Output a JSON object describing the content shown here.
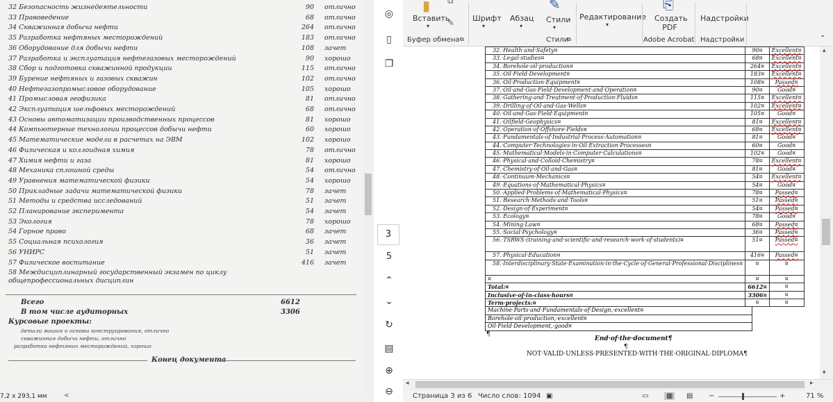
{
  "scan": {
    "rows": [
      {
        "n": "32 Безопасность жизнедеятельности",
        "h": "90",
        "g": "отлично"
      },
      {
        "n": "33 Правоведение",
        "h": "68",
        "g": "отлично"
      },
      {
        "n": "34 Скважинная добыча нефти",
        "h": "264",
        "g": "отлично"
      },
      {
        "n": "35 Разработка нефтяных месторождений",
        "h": "183",
        "g": "отлично"
      },
      {
        "n": "36 Оборудование для добычи нефти",
        "h": "108",
        "g": "зачет"
      },
      {
        "n": "37 Разработка и эксплуатация нефтегазовых месторождений",
        "h": "90",
        "g": "хорошо"
      },
      {
        "n": "38 Сбор и подготовка скважинной продукции",
        "h": "115",
        "g": "отлично"
      },
      {
        "n": "39 Бурение нефтяных и газовых скважин",
        "h": "102",
        "g": "отлично"
      },
      {
        "n": "40 Нефтегазопромысловое оборудование",
        "h": "105",
        "g": "хорошо"
      },
      {
        "n": "41 Промысловая геофизика",
        "h": "81",
        "g": "отлично"
      },
      {
        "n": "42 Эксплуатация шельфовых месторождений",
        "h": "68",
        "g": "отлично"
      },
      {
        "n": "43 Основы автоматизации производственных процессов",
        "h": "81",
        "g": "хорошо"
      },
      {
        "n": "44 Компьютерные технологии процессов добычи нефти",
        "h": "60",
        "g": "хорошо"
      },
      {
        "n": "45 Математические модели в расчетах на ЭВМ",
        "h": "102",
        "g": "хорошо"
      },
      {
        "n": "46 Физическая и коллоидная химия",
        "h": "78",
        "g": "отлично"
      },
      {
        "n": "47 Химия нефти и газа",
        "h": "81",
        "g": "хорошо"
      },
      {
        "n": "48 Механика сплошной среды",
        "h": "54",
        "g": "отлично"
      },
      {
        "n": "49 Уравнения математической физики",
        "h": "54",
        "g": "хорошо"
      },
      {
        "n": "50 Прикладные задачи математической физики",
        "h": "78",
        "g": "зачет"
      },
      {
        "n": "51 Методы и средства исследований",
        "h": "51",
        "g": "зачет"
      },
      {
        "n": "52 Планирование эксперимента",
        "h": "54",
        "g": "зачет"
      },
      {
        "n": "53 Экология",
        "h": "78",
        "g": "хорошо"
      },
      {
        "n": "54 Горное право",
        "h": "68",
        "g": "зачет"
      },
      {
        "n": "55 Социальная психология",
        "h": "36",
        "g": "зачет"
      },
      {
        "n": "56 УНИРС",
        "h": "51",
        "g": "зачет"
      },
      {
        "n": "57 Физическое воспитание",
        "h": "416",
        "g": "зачет"
      },
      {
        "n": "58 Междисциплинарный государственный экзамен по циклу",
        "h": "",
        "g": ""
      },
      {
        "n": "общепрофессиональных дисциплин",
        "h": "",
        "g": ""
      }
    ],
    "total_label": "Всего",
    "total_value": "6612",
    "inclass_label": "В том числе аудиторных",
    "inclass_value": "3306",
    "projects_label": "Курсовые проекты:",
    "projects": [
      "детали машин и основы конструирования, отлично",
      "скважинная добыча нефти, отлично",
      "разработка нефтяных месторождений, хорошо"
    ],
    "end_label": "Конец документа"
  },
  "left_status": {
    "size": "7,2 x 293,1 мм",
    "arrow": "<"
  },
  "side": {
    "page_a": "3",
    "page_b": "5"
  },
  "ribbon": {
    "paste": "Вставить",
    "font": "Шрифт",
    "para": "Абзац",
    "styles": "Стили",
    "editing": "Редактирование",
    "pdf": "Создать PDF",
    "addins": "Надстройки",
    "clipboard_cap": "Буфер обмена",
    "styles_cap": "Стили",
    "acrobat_cap": "Adobe Acrobat",
    "addins_cap": "Надстройки"
  },
  "doc": {
    "rows": [
      {
        "n": "32.·Health·and·Safety¤",
        "h": "90¤",
        "g": "Excellent¤",
        "x": true
      },
      {
        "n": "33.·Legal·studies¤",
        "h": "68¤",
        "g": "Excellent¤",
        "x": true
      },
      {
        "n": "34.·Borehole·oil·production¤",
        "h": "264¤",
        "g": "Excellent¤",
        "x": true
      },
      {
        "n": "35.·Oil·Field·Development¤",
        "h": "183¤",
        "g": "Excellent¤",
        "x": true
      },
      {
        "n": "36.·Oil·Production·Equipment¤",
        "h": "108¤",
        "g": "Passed¤",
        "x": true
      },
      {
        "n": "37.·Oil·and·Gas·Field·Development·and·Operation¤",
        "h": "90¤",
        "g": "Good¤",
        "x": false
      },
      {
        "n": "38.·Gathering·and·Treatment·of·Production·Fluids¤",
        "h": "115¤",
        "g": "Excellent¤",
        "x": true
      },
      {
        "n": "39.·Drilling·of·Oil·and·Gas·Wells¤",
        "h": "102¤",
        "g": "Excellent¤",
        "x": true
      },
      {
        "n": "40.·Oil·and·Gas·Field·Equipment¤",
        "h": "105¤",
        "g": "Good¤",
        "x": false
      },
      {
        "n": "41.·Oilfield·Geophysics¤",
        "h": "81¤",
        "g": "Excellent¤",
        "x": true
      },
      {
        "n": "42.·Operation·of·Offshore·Fields¤",
        "h": "68¤",
        "g": "Excellent¤",
        "x": true
      },
      {
        "n": "43.·Fundamentals·of·Industrial·Process·Automation¤",
        "h": "81¤",
        "g": "Good¤",
        "x": false
      },
      {
        "n": "44.·Computer·Technologies·in·Oil·Extraction·Processes¤",
        "h": "60¤",
        "g": "Good¤",
        "x": false
      },
      {
        "n": "45.·Mathematical·Models·in·Computer·Calculations¤",
        "h": "102¤",
        "g": "Good¤",
        "x": false
      },
      {
        "n": "46.·Physical·and·Colloid·Chemistry¤",
        "h": "78¤",
        "g": "Excellent¤",
        "x": true
      },
      {
        "n": "47.·Chemistry·of·Oil·and·Gas¤",
        "h": "81¤",
        "g": "Good¤",
        "x": false
      },
      {
        "n": "48.·Continuum·Mechanics¤",
        "h": "54¤",
        "g": "Excellent¤",
        "x": true
      },
      {
        "n": "49.·Equations·of·Mathematical·Physics¤",
        "h": "54¤",
        "g": "Good¤",
        "x": false
      },
      {
        "n": "50.·Applied·Problems·of·Mathematical·Physics¤",
        "h": "78¤",
        "g": "Passed¤",
        "x": true
      },
      {
        "n": "51.·Research·Methods·and·Tools¤",
        "h": "51¤",
        "g": "Passed¤",
        "x": true
      },
      {
        "n": "52.·Design·of·Experiment¤",
        "h": "54¤",
        "g": "Passed¤",
        "x": true
      },
      {
        "n": "53.·Ecology¤",
        "h": "78¤",
        "g": "Good¤",
        "x": false
      },
      {
        "n": "54.·Mining·Law¤",
        "h": "68¤",
        "g": "Passed¤",
        "x": true
      },
      {
        "n": "55.·Social·Psychology¤",
        "h": "36¤",
        "g": "Passed¤",
        "x": true
      },
      {
        "n": "56.·TSRWS·(training·and·scientific·and·research·work·of·students)¤",
        "h": "51¤",
        "g": "Passed¤",
        "x": true
      },
      {
        "n": "57.·Physical·Education¤",
        "h": "416¤",
        "g": "Passed¤",
        "x": true
      },
      {
        "n": "58.·Interdisciplinary·State·Examination·in·the·Cycle·of·General·Professional·Disciplines¤",
        "h": "¤",
        "g": "¤",
        "x": false
      }
    ],
    "blank": "¤",
    "total_label": "Total:¤",
    "total_value": "6612¤",
    "inclass_label": "Inclusive·of·in-class·hours¤",
    "inclass_value": "3306¤",
    "projects_label": "Term·projects:¤",
    "projects": [
      "Machine·Parts·and·Fundamentals·of·Design,·excellent¤",
      "Borehole·oil·production,·excellent¤",
      "Oil·Field·Development,·good¤"
    ],
    "pilcrow": "¶",
    "end": "End·of·the·document¶",
    "notvalid": "NOT·VALID·UNLESS·PRESENTED·WITH·THE·ORIGINAL·DIPLOMA¶"
  },
  "status": {
    "page": "Страница 3 из 6",
    "words": "Число слов: 1094",
    "zoom": "71 %"
  }
}
